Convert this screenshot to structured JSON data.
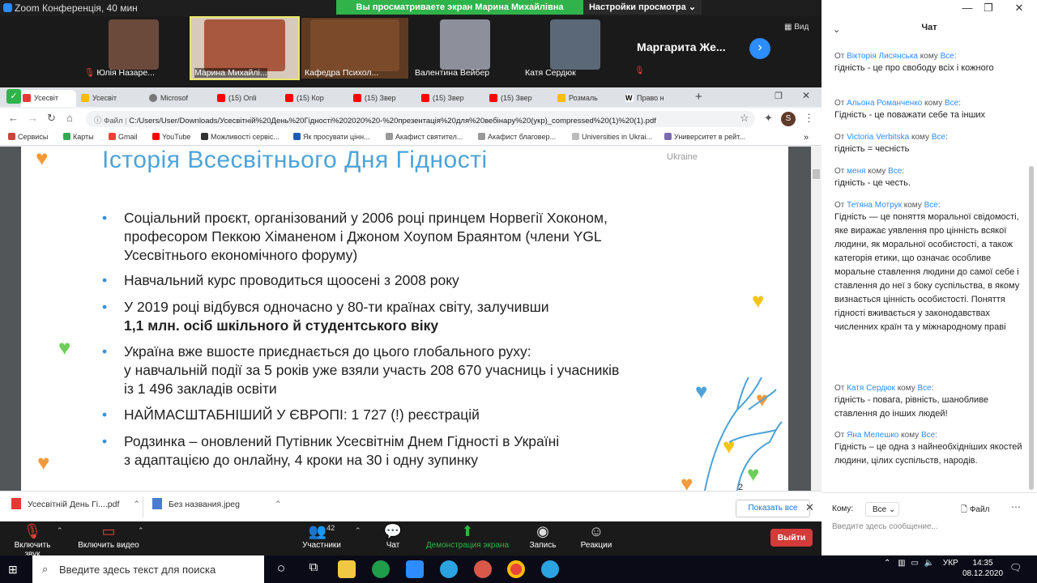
{
  "window": {
    "title": "Zoom Конференція, 40 мин"
  },
  "banner": {
    "text": "Вы просматриваете экран Марина Михайлівна Ячменик",
    "view_options": "Настройки просмотра ⌄"
  },
  "gallery": {
    "tiles": [
      {
        "name": "Юлія Назаре...",
        "mic_off": true,
        "color": "#6b4a3c"
      },
      {
        "name": "Марина Михайлі...",
        "mic_off": false,
        "color": "#a8583e"
      },
      {
        "name": "Кафедра Психол...",
        "mic_off": false,
        "color": "#7a4a2a"
      },
      {
        "name": "Валентина Вейбер",
        "mic_off": true,
        "color": "#8d8f9a"
      },
      {
        "name": "Катя Сердюк",
        "mic_off": false,
        "color": "#5a6878"
      }
    ],
    "big_name": "Маргарита Же...",
    "view_label": "Вид"
  },
  "browser": {
    "tabs": [
      "Усесвіт",
      "Усесвіт",
      "Microsof",
      "(15) Onli",
      "(15) Кор",
      "(15) Звер",
      "(15) Звер",
      "(15) Звер",
      "Розмаль",
      "Право н"
    ],
    "url_prefix": "Файл",
    "url": "C:/Users/User/Downloads/Усесвітній%20День%20Гідності%202020%20-%20презентація%20для%20вебінару%20(укр)_compressed%20(1)%20(1).pdf",
    "bookmarks": [
      "Сервисы",
      "Карты",
      "Gmail",
      "YouTube",
      "Можливості сервіс...",
      "Як просувати цінн...",
      "Акафист святител...",
      "Акафист благовер...",
      "Universities in Ukrai...",
      "Университет в рейт..."
    ]
  },
  "slide": {
    "title": "Історія Всесвітнього Дня Гідності",
    "brand": "Ukraine",
    "bullets": [
      [
        "Соціальний проєкт, організований у 2006 році принцем Норвегії Хоконом,",
        "професором Пеккою Хіманеном і Джоном Хоупом Браянтом (члени YGL",
        "Усесвітнього економічного форуму)"
      ],
      [
        "Навчальний курс проводиться щоосені з 2008 року"
      ],
      [
        "У 2019 році відбувся одночасно у 80-ти країнах світу, залучивши",
        "1,1 млн. осіб шкільного й студентського віку"
      ],
      [
        "Україна вже вшосте приєднається до цього глобального руху:",
        "у навчальній події за 5 років уже взяли участь 208 670 учасниць і учасників",
        "із 1 496 закладів освіти"
      ],
      [
        "НАЙМАСШТАБНІШИЙ У ЄВРОПІ: 1 727 (!) реєстрацій"
      ],
      [
        "Родзинка – оновлений Путівник Усесвітнім Днем Гідності в Україні",
        "з адаптацією до онлайну, 4 кроки на 30 і одну зупинку"
      ]
    ],
    "page_no": "2"
  },
  "downloads": {
    "items": [
      {
        "name": "Усесвітній День Гі....pdf"
      },
      {
        "name": "Без названия.jpeg"
      }
    ],
    "show_all": "Показать все"
  },
  "controls": {
    "mute": "Включить звук",
    "video": "Включить видео",
    "participants": "Участники",
    "participants_count": "42",
    "chat": "Чат",
    "share": "Демонстрация экрана",
    "record": "Запись",
    "reactions": "Реакции",
    "leave": "Выйти"
  },
  "chat": {
    "header": "Чат",
    "messages": [
      {
        "from": "Вікторія Лисянська",
        "to": "Все",
        "text": "гідність - це про свободу всіх і кожного"
      },
      {
        "from": "Альона Романченко",
        "to": "Все",
        "text": "Гідність - це поважати себе та інших"
      },
      {
        "from": "Victoria Verbitska",
        "to": "Все",
        "text": "гідність = чесність"
      },
      {
        "from": "меня",
        "to": "Все",
        "text": "гідність - це честь."
      },
      {
        "from": "Тетяна Мотрук",
        "to": "Все",
        "text": "Гідність — це поняття моральної свідомості, яке виражає уявлення про цінність всякої людини, як моральної особистості, а також категорія етики, що означає особливе моральне ставлення людини до самої себе і ставлення до неї з боку суспільства, в якому визнається цінність особистості. Поняття гідності вживається у законодавствах численних країн та у міжнародному праві"
      },
      {
        "from": "Катя Сердюк",
        "to": "Все",
        "text": "гідність - повага, рівність, шанобливе ставлення до інших людей!"
      },
      {
        "from": "Яна Мелешко",
        "to": "Все",
        "text": "Гідність – це одна з найнеобхідніших якостей людини, цілих суспільств, народів."
      }
    ],
    "label_from": "От",
    "label_to": "кому",
    "recipient_label": "Кому:",
    "recipient_value": "Все",
    "file_label": "Файл",
    "input_placeholder": "Введите здесь сообщение..."
  },
  "taskbar": {
    "search_placeholder": "Введите здесь текст для поиска",
    "lang": "УКР",
    "time": "14:35",
    "date": "08.12.2020"
  }
}
